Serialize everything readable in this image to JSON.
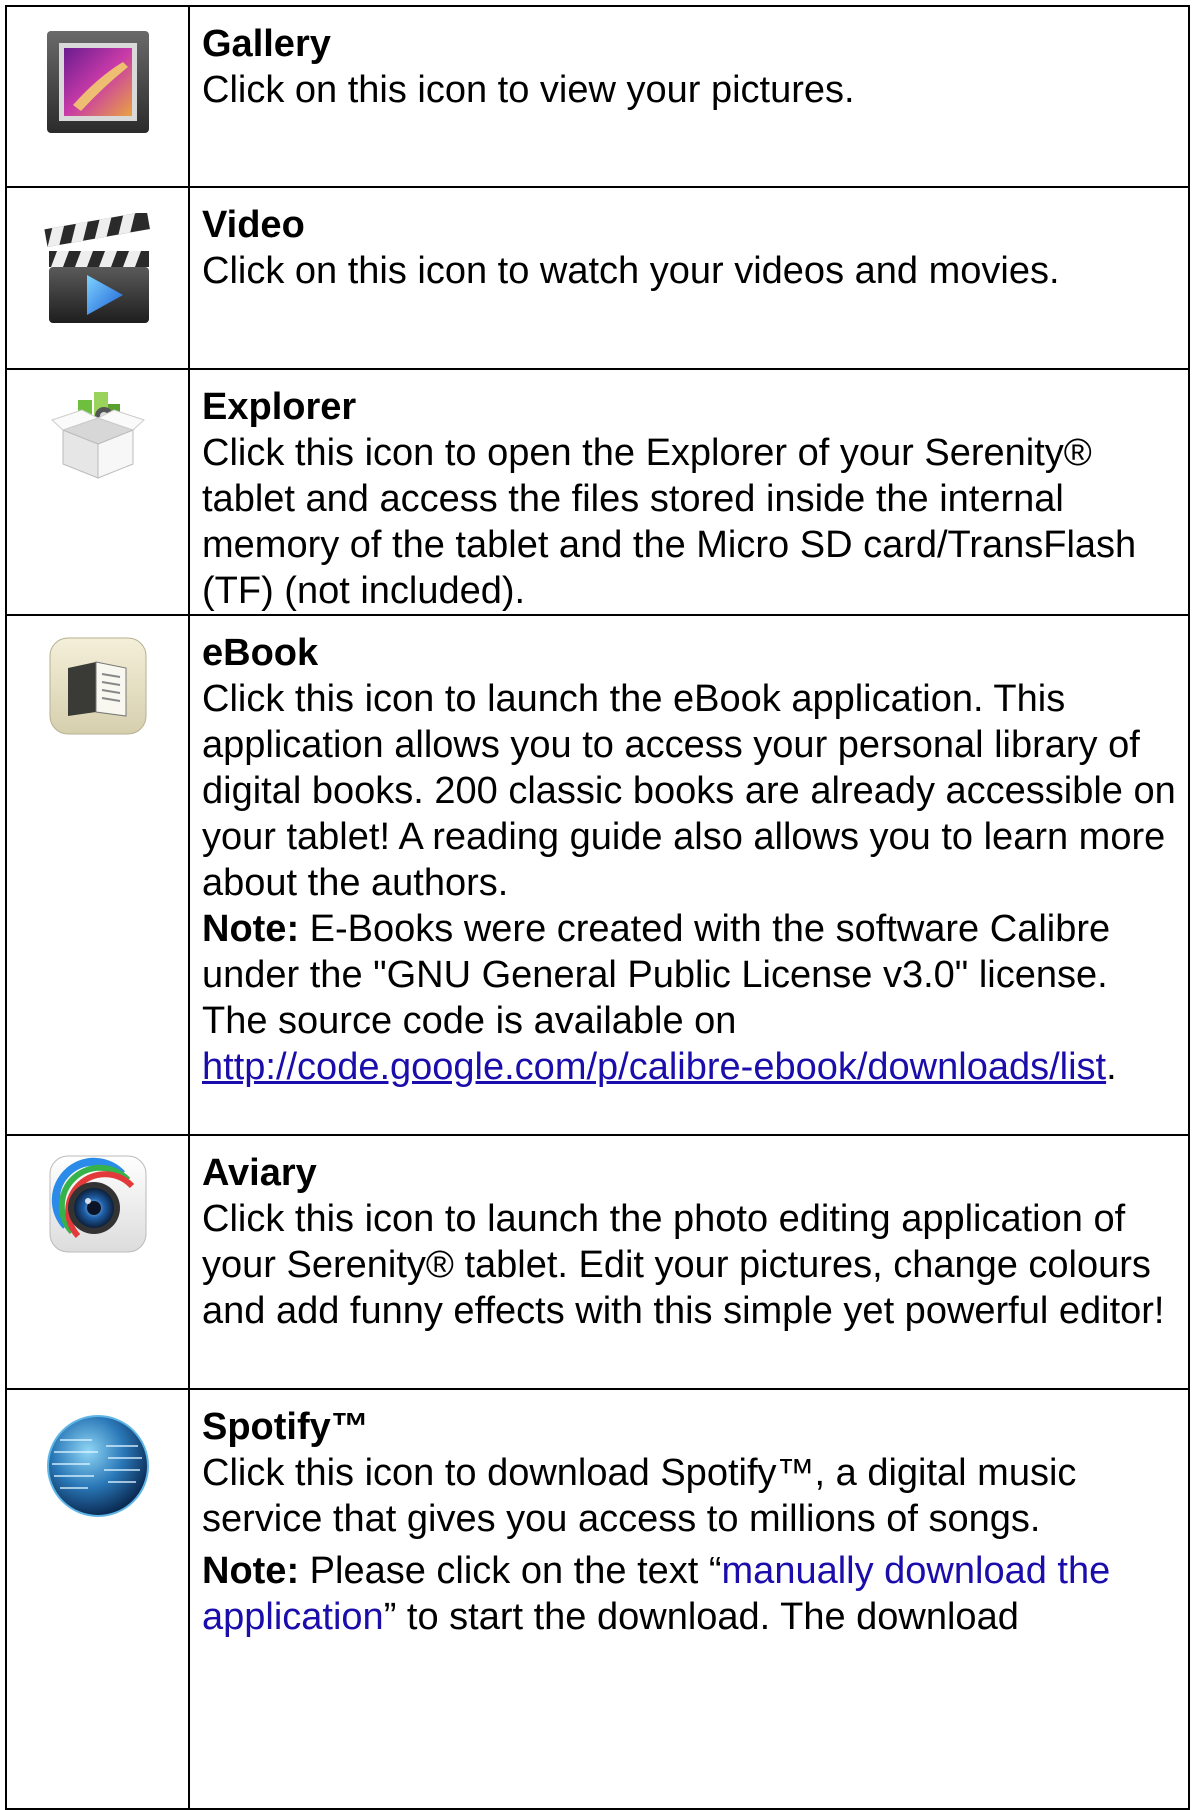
{
  "rows": [
    {
      "title": "Gallery",
      "description": "Click on this icon to view your pictures.",
      "icon": "gallery-icon"
    },
    {
      "title": "Video",
      "description": "Click on this icon to watch your videos and movies.",
      "icon": "clapperboard-icon"
    },
    {
      "title": "Explorer",
      "description": "Click this icon to open the Explorer of your Serenity® tablet and access the files stored inside the internal memory of the tablet and the Micro SD card/TransFlash (TF) (not included).",
      "icon": "box-icon"
    },
    {
      "title": "eBook",
      "description": "Click this icon to launch the eBook application. This application allows you to access your personal library of digital books. 200 classic books are already accessible on your tablet! A reading guide also allows you to learn more about the authors.",
      "note_label": "Note:",
      "note_text": " E-Books were created with the software Calibre under the \"GNU General Public License v3.0\" license. The source code is available on ",
      "note_link": "http://code.google.com/p/calibre-ebook/downloads/list",
      "note_end": ".",
      "icon": "book-icon"
    },
    {
      "title": "Aviary",
      "description": "Click this icon to launch the photo editing application of your Serenity® tablet. Edit your pictures, change colours and add funny effects with this simple yet powerful editor!",
      "icon": "camera-lens-icon"
    },
    {
      "title": "Spotify™",
      "description": "Click this icon to download Spotify™, a digital music service that gives you access to millions of songs.",
      "note_label": "Note:",
      "note_text": " Please click on the text “",
      "note_link": "manually download the application",
      "note_end": "” to start the download. The download",
      "icon": "globe-icon"
    }
  ],
  "colors": {
    "link": "#1a0dab",
    "border": "#000000"
  }
}
